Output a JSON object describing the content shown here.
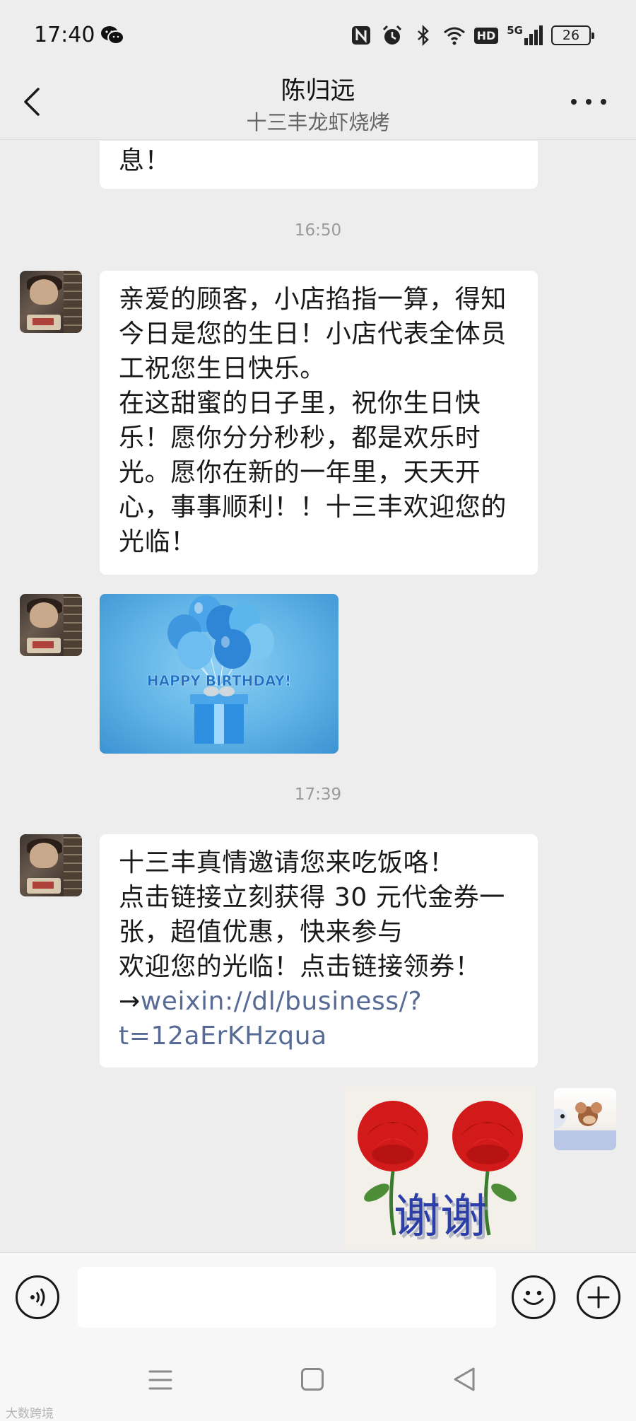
{
  "status_bar": {
    "time": "17:40",
    "icons": [
      "wechat-icon",
      "nfc-icon",
      "alarm-icon",
      "bluetooth-icon",
      "wifi-icon",
      "hd-icon",
      "signal-5g-icon",
      "battery-icon"
    ],
    "hd_label": "HD",
    "network_label": "5G",
    "battery_level": "26"
  },
  "header": {
    "title": "陈归远",
    "subtitle": "十三丰龙虾烧烤"
  },
  "messages": {
    "partial": {
      "lines": [
        "息！"
      ]
    },
    "time1": "16:50",
    "birthday": {
      "lines": [
        "亲爱的顾客，小店掐指一算，得知",
        "今日是您的生日！小店代表全体员",
        "工祝您生日快乐。",
        "在这甜蜜的日子里，祝你生日快",
        "乐！愿你分分秒秒，都是欢乐时",
        "光。愿你在新的一年里，天天开",
        "心，事事顺利！！十三丰欢迎您的",
        "光临！"
      ]
    },
    "birthday_card": {
      "caption": "HAPPY BIRTHDAY!"
    },
    "time2": "17:39",
    "invite": {
      "lines": [
        "十三丰真情邀请您来吃饭咯！",
        "点击链接立刻获得 30 元代金券一",
        "张，超值优惠，快来参与",
        "欢迎您的光临！点击链接领券！"
      ],
      "arrow": "→",
      "link_line1": "weixin://dl/business/?",
      "link_line2": "t=12aErKHzqua"
    },
    "sticker": {
      "text": "谢谢"
    }
  },
  "input_bar": {
    "placeholder": ""
  },
  "watermark": "大数跨境"
}
